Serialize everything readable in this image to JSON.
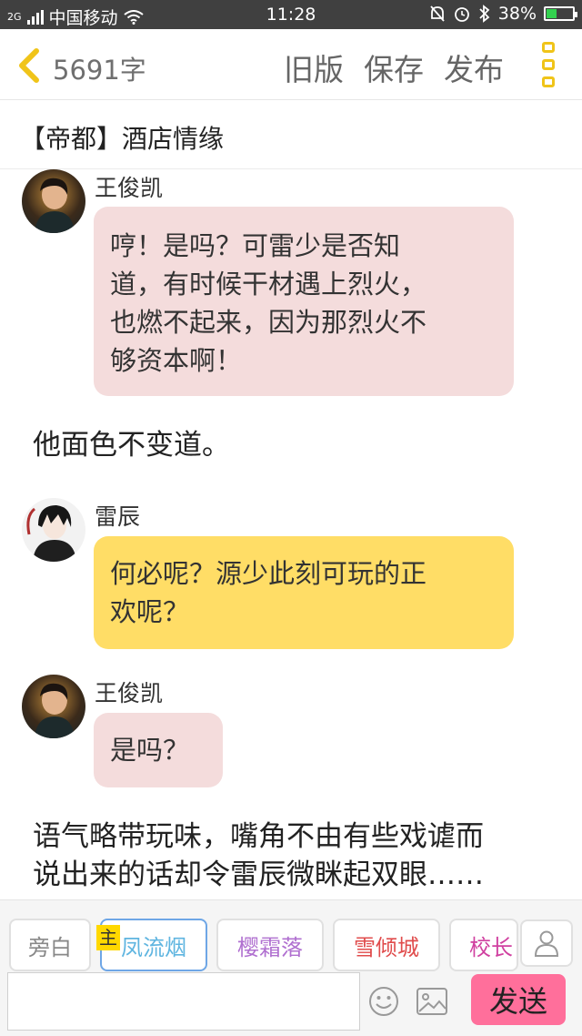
{
  "status_bar": {
    "network": "2G",
    "carrier": "中国移动",
    "time": "11:28",
    "battery_text": "38%",
    "battery_level": 0.38,
    "icons": [
      "signal-icon",
      "wifi-icon",
      "mute-bell-icon",
      "alarm-icon",
      "bluetooth-icon",
      "battery-icon"
    ]
  },
  "toolbar": {
    "back_icon": "chevron-left-icon",
    "word_count": "5691字",
    "old_version": "旧版",
    "save": "保存",
    "publish": "发布",
    "more_icon": "more-vertical-icon",
    "accent_color": "#f0c419"
  },
  "story": {
    "title": "【帝都】酒店情缘"
  },
  "messages": [
    {
      "speaker": "王俊凯",
      "lines": [
        "哼！是吗？可雷少是否知",
        "道，有时候干材遇上烈火，",
        "也燃不起来，因为那烈火不",
        "够资本啊！"
      ],
      "bubble_color": "#f4dcdc"
    },
    {
      "narration": "他面色不变道。"
    },
    {
      "speaker": "雷辰",
      "lines": [
        "何必呢？源少此刻可玩的正",
        "欢呢？"
      ],
      "bubble_color": "#ffdd66"
    },
    {
      "speaker": "王俊凯",
      "lines": [
        "是吗？"
      ],
      "bubble_color": "#f4dcdc"
    },
    {
      "narration_lines": [
        "语气略带玩味，嘴角不由有些戏谑而",
        "说出来的话却令雷辰微眯起双眼……"
      ]
    }
  ],
  "character_bar": {
    "chips": [
      {
        "label": "旁白",
        "color": "#888888"
      },
      {
        "label": "凤流烟",
        "color": "#5fb5e0"
      },
      {
        "label": "樱霜落",
        "color": "#b070d0"
      },
      {
        "label": "雪倾城",
        "color": "#e04c4c"
      },
      {
        "label": "校长",
        "color": "#d040a0"
      }
    ],
    "main_tag": "主",
    "person_icon": "person-icon"
  },
  "input_bar": {
    "placeholder": "",
    "emoji_icon": "emoji-icon",
    "image_icon": "image-icon",
    "send": "发送",
    "send_color": "#ff6f9b"
  }
}
